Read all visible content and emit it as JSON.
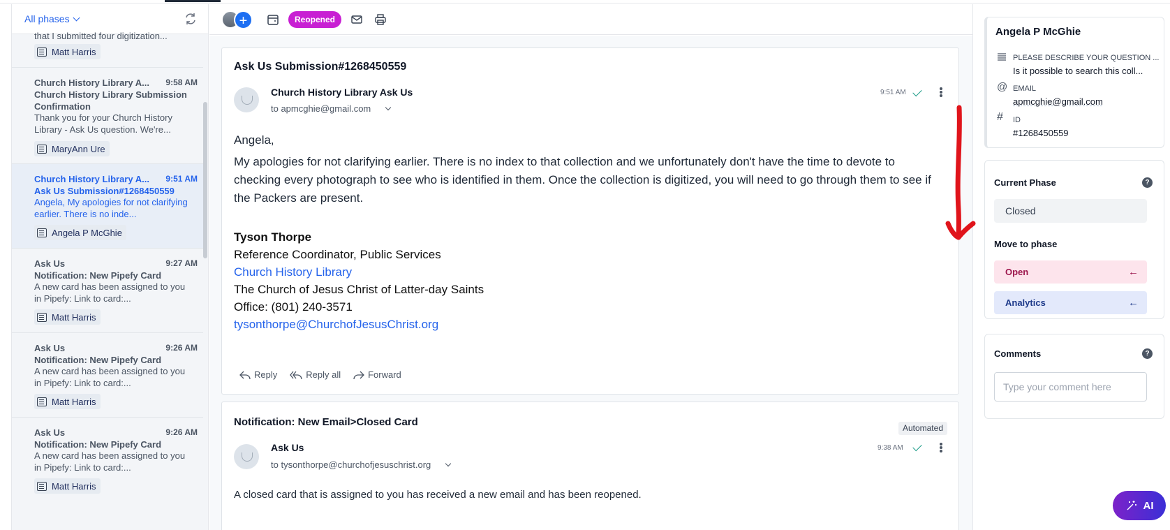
{
  "left": {
    "phases_label": "All phases",
    "top_partial_preview": "that I submitted four digitization...",
    "items": [
      {
        "tag": "Matt Harris"
      },
      {
        "from": "Church History Library A...",
        "time": "9:58 AM",
        "subject": "Church History Library Submission Confirmation",
        "preview": "Thank you for your Church History Library - Ask Us question. We're...",
        "tag": "MaryAnn Ure"
      },
      {
        "from": "Church History Library A...",
        "time": "9:51 AM",
        "subject": "Ask Us Submission#1268450559",
        "preview": "Angela, My apologies for not clarifying earlier. There is no inde...",
        "tag": "Angela P McGhie"
      },
      {
        "from": "Ask Us",
        "time": "9:27 AM",
        "subject": "Notification: New Pipefy Card",
        "preview": "A new card has been assigned to you in Pipefy:      Link to card:...",
        "tag": "Matt Harris"
      },
      {
        "from": "Ask Us",
        "time": "9:26 AM",
        "subject": "Notification: New Pipefy Card",
        "preview": "A new card has been assigned to you in Pipefy:      Link to card:...",
        "tag": "Matt Harris"
      },
      {
        "from": "Ask Us",
        "time": "9:26 AM",
        "subject": "Notification: New Pipefy Card",
        "preview": "A new card has been assigned to you in Pipefy:      Link to card:...",
        "tag": "Matt Harris"
      }
    ]
  },
  "toolbar": {
    "status_badge": "Reopened",
    "icons": [
      "avatar",
      "add-member-icon",
      "calendar-icon",
      "mail-icon",
      "print-icon"
    ]
  },
  "email1": {
    "title": "Ask Us Submission#1268450559",
    "sender": "Church History Library Ask Us",
    "to": "to apmcghie@gmail.com",
    "time": "9:51 AM",
    "greeting": "Angela,",
    "body": "My apologies for not clarifying earlier. There is no index to that collection and we unfortunately don't have the time to devote to checking every photograph to see who is identified in them. Once the collection is digitized, you will need to go through them to see if the Packers are present.",
    "sig_name": "Tyson Thorpe",
    "sig_role": "Reference Coordinator, Public Services",
    "sig_org_link": "Church History Library",
    "sig_church": "The Church of Jesus Christ of Latter-day Saints",
    "sig_office": "Office: (801) 240-3571",
    "sig_email": "tysonthorpe@ChurchofJesusChrist.org",
    "reply": "Reply",
    "reply_all": "Reply all",
    "forward": "Forward"
  },
  "email2": {
    "title": "Notification: New Email>Closed Card",
    "badge": "Automated",
    "sender": "Ask Us",
    "to": "to tysonthorpe@churchofjesuschrist.org",
    "time": "9:38 AM",
    "body": "A closed card that is assigned to you has received a new email and has been reopened."
  },
  "right": {
    "contact_name": "Angela P McGhie",
    "q_label": "PLEASE DESCRIBE YOUR QUESTION ...",
    "q_value": "Is it possible to search this coll...",
    "email_label": "EMAIL",
    "email_value": "apmcghie@gmail.com",
    "id_label": "ID",
    "id_value": "#1268450559",
    "current_phase_title": "Current Phase",
    "current_phase": "Closed",
    "move_title": "Move to phase",
    "move_open": "Open",
    "move_analytics": "Analytics",
    "comments_title": "Comments",
    "comment_placeholder": "Type your comment here",
    "ai_label": "AI"
  },
  "colors": {
    "accent_blue": "#2563eb",
    "reopened_badge": "#c81fd3",
    "open_btn_bg": "#fde4ec",
    "open_btn_text": "#9d174d",
    "analytics_btn_bg": "#e3e9fb",
    "analytics_btn_text": "#1e3a8a",
    "annotation_red": "#e0141b"
  }
}
